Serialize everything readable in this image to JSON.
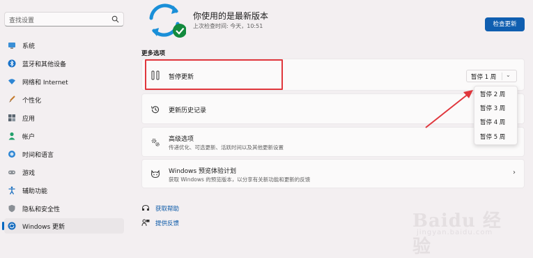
{
  "sidebar": {
    "search_placeholder": "查找设置",
    "items": [
      {
        "label": "系统",
        "icon": "monitor-icon"
      },
      {
        "label": "蓝牙和其他设备",
        "icon": "bluetooth-icon"
      },
      {
        "label": "网络和 Internet",
        "icon": "wifi-icon"
      },
      {
        "label": "个性化",
        "icon": "brush-icon"
      },
      {
        "label": "应用",
        "icon": "apps-icon"
      },
      {
        "label": "帐户",
        "icon": "person-icon"
      },
      {
        "label": "时间和语言",
        "icon": "globe-clock-icon"
      },
      {
        "label": "游戏",
        "icon": "gamepad-icon"
      },
      {
        "label": "辅助功能",
        "icon": "accessibility-icon"
      },
      {
        "label": "隐私和安全性",
        "icon": "shield-icon"
      },
      {
        "label": "Windows 更新",
        "icon": "update-icon",
        "active": true
      }
    ]
  },
  "status": {
    "title": "你使用的是最新版本",
    "last_checked": "上次检查时间: 今天，10:51",
    "check_button": "检查更新"
  },
  "more_options": {
    "title": "更多选项",
    "pause": {
      "label": "暂停更新",
      "selected": "暂停 1 周",
      "options": [
        "暂停 2 周",
        "暂停 3 周",
        "暂停 4 周",
        "暂停 5 周"
      ]
    },
    "history": {
      "label": "更新历史记录"
    },
    "advanced": {
      "label": "高级选项",
      "sub": "传递优化、可选更新、活跃时间以及其他更新设置"
    },
    "insider": {
      "label": "Windows 预览体验计划",
      "sub": "获取 Windows 的预览版本，以分享有关新功能和更新的反馈"
    }
  },
  "links": {
    "help": "获取帮助",
    "feedback": "提供反馈"
  },
  "watermark": {
    "main": "Baidu 经验",
    "sub": "jingyan.baidu.com"
  },
  "colors": {
    "accent": "#0f5eb0",
    "highlight_red": "#e0363c",
    "link": "#0a59a8"
  }
}
